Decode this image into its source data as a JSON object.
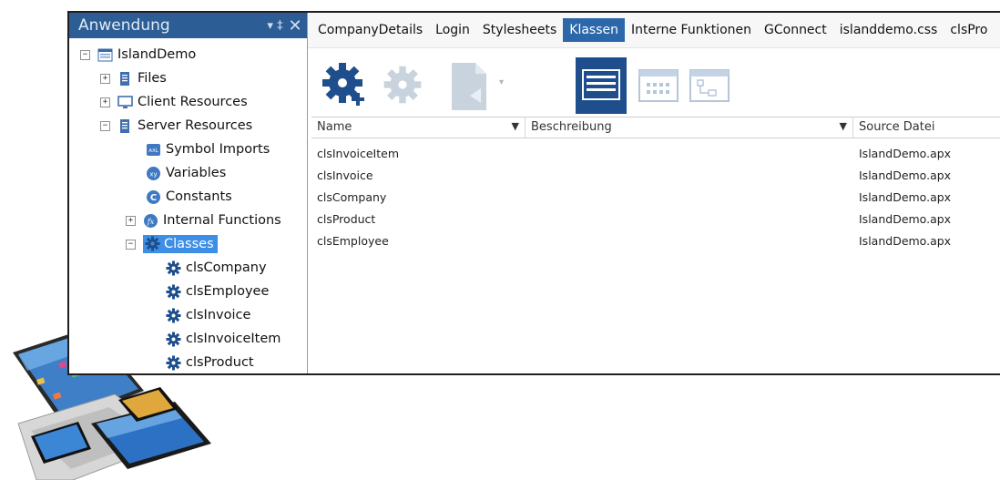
{
  "panel": {
    "title": "Anwendung",
    "pin_glyph": "▾ ‡",
    "close_glyph": "✕"
  },
  "tree": {
    "root": "IslandDemo",
    "files": "Files",
    "client_resources": "Client Resources",
    "server_resources": "Server Resources",
    "symbol_imports": "Symbol Imports",
    "variables": "Variables",
    "constants": "Constants",
    "internal_functions": "Internal Functions",
    "classes": "Classes",
    "class_items": [
      "clsCompany",
      "clsEmployee",
      "clsInvoice",
      "clsInvoiceItem",
      "clsProduct"
    ]
  },
  "tabs": [
    "CompanyDetails",
    "Login",
    "Stylesheets",
    "Klassen",
    "Interne Funktionen",
    "GConnect",
    "islanddemo.css",
    "clsPro"
  ],
  "active_tab": "Klassen",
  "grid": {
    "headers": [
      "Name",
      "Beschreibung",
      "Source Datei"
    ],
    "rows": [
      {
        "name": "clsInvoiceItem",
        "desc": "",
        "source": "IslandDemo.apx"
      },
      {
        "name": "clsInvoice",
        "desc": "",
        "source": "IslandDemo.apx"
      },
      {
        "name": "clsCompany",
        "desc": "",
        "source": "IslandDemo.apx"
      },
      {
        "name": "clsProduct",
        "desc": "",
        "source": "IslandDemo.apx"
      },
      {
        "name": "clsEmployee",
        "desc": "",
        "source": "IslandDemo.apx"
      }
    ]
  },
  "colors": {
    "panel_header": "#2c5d95",
    "selection": "#3d8ee6",
    "active_tab": "#2c67a9",
    "toolbar_icon": "#1e4f8c",
    "toolbar_disabled": "#c9d3de"
  },
  "icons": {
    "toolbar": [
      "add-class-gear-icon",
      "gear-icon",
      "document-icon",
      "list-view-icon",
      "grid-view-icon",
      "diagram-view-icon"
    ]
  }
}
